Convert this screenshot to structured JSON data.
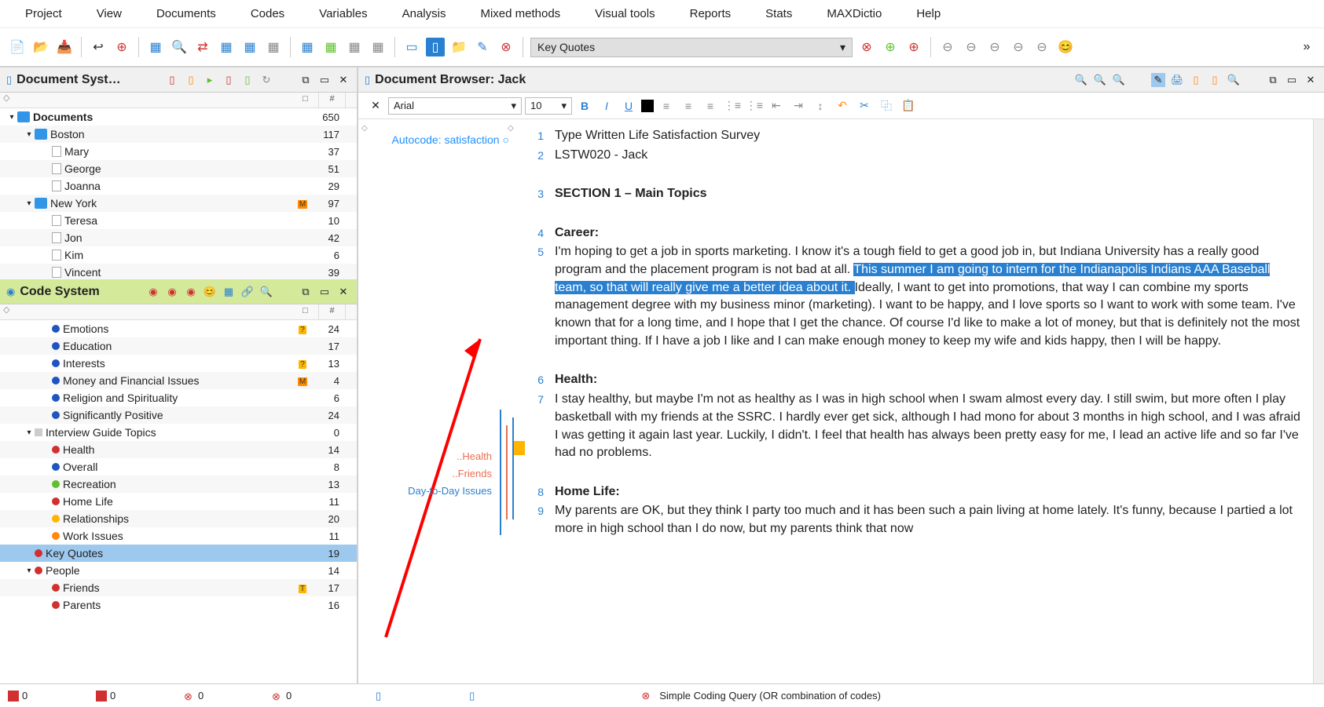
{
  "menu": [
    "Project",
    "View",
    "Documents",
    "Codes",
    "Variables",
    "Analysis",
    "Mixed methods",
    "Visual tools",
    "Reports",
    "Stats",
    "MAXDictio",
    "Help"
  ],
  "toolbar_select": "Key Quotes",
  "doc_system": {
    "title": "Document Syst…",
    "columns": [
      "□",
      "#"
    ],
    "rows": [
      {
        "level": 0,
        "expand": "▾",
        "icon": "folder",
        "label": "Documents",
        "badge": "",
        "count": "650",
        "bold": true
      },
      {
        "level": 1,
        "expand": "▾",
        "icon": "folder",
        "label": "Boston",
        "badge": "",
        "count": "117"
      },
      {
        "level": 2,
        "icon": "doc",
        "label": "Mary",
        "count": "37"
      },
      {
        "level": 2,
        "icon": "doc",
        "label": "George",
        "count": "51"
      },
      {
        "level": 2,
        "icon": "doc",
        "label": "Joanna",
        "count": "29"
      },
      {
        "level": 1,
        "expand": "▾",
        "icon": "folder",
        "label": "New York",
        "badge": "M",
        "badgeColor": "#ff8c00",
        "count": "97"
      },
      {
        "level": 2,
        "icon": "doc",
        "label": "Teresa",
        "count": "10"
      },
      {
        "level": 2,
        "icon": "doc",
        "label": "Jon",
        "count": "42"
      },
      {
        "level": 2,
        "icon": "doc",
        "label": "Kim",
        "count": "6"
      },
      {
        "level": 2,
        "icon": "doc",
        "label": "Vincent",
        "count": "39"
      }
    ]
  },
  "code_system": {
    "title": "Code System",
    "columns": [
      "□",
      "#"
    ],
    "rows": [
      {
        "level": 2,
        "dot": "#1e55c0",
        "label": "Emotions",
        "badge": "?",
        "badgeColor": "#ffb400",
        "count": "24"
      },
      {
        "level": 2,
        "dot": "#1e55c0",
        "label": "Education",
        "count": "17"
      },
      {
        "level": 2,
        "dot": "#1e55c0",
        "label": "Interests",
        "badge": "?",
        "badgeColor": "#ffb400",
        "count": "13"
      },
      {
        "level": 2,
        "dot": "#1e55c0",
        "label": "Money and Financial Issues",
        "badge": "M",
        "badgeColor": "#ff8c00",
        "count": "4"
      },
      {
        "level": 2,
        "dot": "#1e55c0",
        "label": "Religion and Spirituality",
        "count": "6"
      },
      {
        "level": 2,
        "dot": "#1e55c0",
        "label": "Significantly Positive",
        "count": "24"
      },
      {
        "level": 1,
        "expand": "▾",
        "gray": true,
        "label": "Interview Guide Topics",
        "count": "0"
      },
      {
        "level": 2,
        "dot": "#d03030",
        "label": "Health",
        "count": "14"
      },
      {
        "level": 2,
        "dot": "#1e55c0",
        "label": "Overall",
        "count": "8"
      },
      {
        "level": 2,
        "dot": "#5fbf2f",
        "label": "Recreation",
        "count": "13"
      },
      {
        "level": 2,
        "dot": "#d03030",
        "label": "Home Life",
        "count": "11"
      },
      {
        "level": 2,
        "dot": "#ffb400",
        "label": "Relationships",
        "count": "20"
      },
      {
        "level": 2,
        "dot": "#ff8810",
        "label": "Work Issues",
        "count": "11"
      },
      {
        "level": 1,
        "dot": "#d03030",
        "label": "Key Quotes",
        "count": "19",
        "selected": true
      },
      {
        "level": 1,
        "expand": "▾",
        "dot": "#d03030",
        "label": "People",
        "count": "14"
      },
      {
        "level": 2,
        "dot": "#d03030",
        "label": "Friends",
        "badge": "T",
        "badgeColor": "#ffb400",
        "count": "17"
      },
      {
        "level": 2,
        "dot": "#d03030",
        "label": "Parents",
        "count": "16"
      }
    ]
  },
  "doc_browser": {
    "title": "Document Browser: Jack",
    "font_name": "Arial",
    "font_size": "10",
    "autocode": "Autocode: satisfaction",
    "strip_labels": {
      "health": "..Health",
      "friends": "..Friends",
      "d2d": "Day-to-Day Issues"
    },
    "paras": [
      {
        "n": "1",
        "txt": "Type Written Life Satisfaction Survey"
      },
      {
        "n": "2",
        "txt": "LSTW020 - Jack"
      },
      {
        "n": "",
        "txt": ""
      },
      {
        "n": "3",
        "txt": "SECTION 1 – Main Topics",
        "bold": true
      },
      {
        "n": "",
        "txt": ""
      },
      {
        "n": "4",
        "txt": "Career:",
        "bold": true
      },
      {
        "n": "5",
        "pre": "I'm hoping to get a job in sports marketing.  I know it's a tough field to get a good job in, but Indiana University has a really good program and the placement program is not bad at all.  ",
        "hl": "This summer I am going to intern for the Indianapolis Indians AAA Baseball team, so that will really give me a better idea about it. ",
        "post": " Ideally, I want to get into promotions, that way I can combine my sports management degree with my business minor (marketing). I want to be happy, and I love sports so I want to work with some team.  I've known that for a long time, and I hope that I get the chance.  Of course I'd like to make a lot of money, but that is definitely not the most important thing.  If I have a job I like and I can make enough money to keep my wife and kids happy, then I will be happy."
      },
      {
        "n": "",
        "txt": ""
      },
      {
        "n": "6",
        "txt": "Health:",
        "bold": true
      },
      {
        "n": "7",
        "txt": "I stay healthy, but maybe I'm not as healthy as I was in high school when I swam almost every day.  I still swim, but more often I play basketball with my friends at the SSRC.  I hardly ever get sick, although I had mono for about 3 months in high school, and I was afraid I was getting it again last year.  Luckily, I didn't.  I feel that health has always been pretty easy for me, I lead an active life and so far I've had no problems."
      },
      {
        "n": "",
        "txt": ""
      },
      {
        "n": "8",
        "txt": "Home Life:",
        "bold": true
      },
      {
        "n": "9",
        "txt": "My parents are OK, but they think I party too much and it has been such a pain living at home lately.  It's funny, because I partied a lot more in high school than I do now, but my parents think that now"
      }
    ]
  },
  "status": {
    "c1": "0",
    "c2": "0",
    "c3": "0",
    "c4": "0",
    "query": "Simple Coding Query (OR combination of codes)"
  }
}
